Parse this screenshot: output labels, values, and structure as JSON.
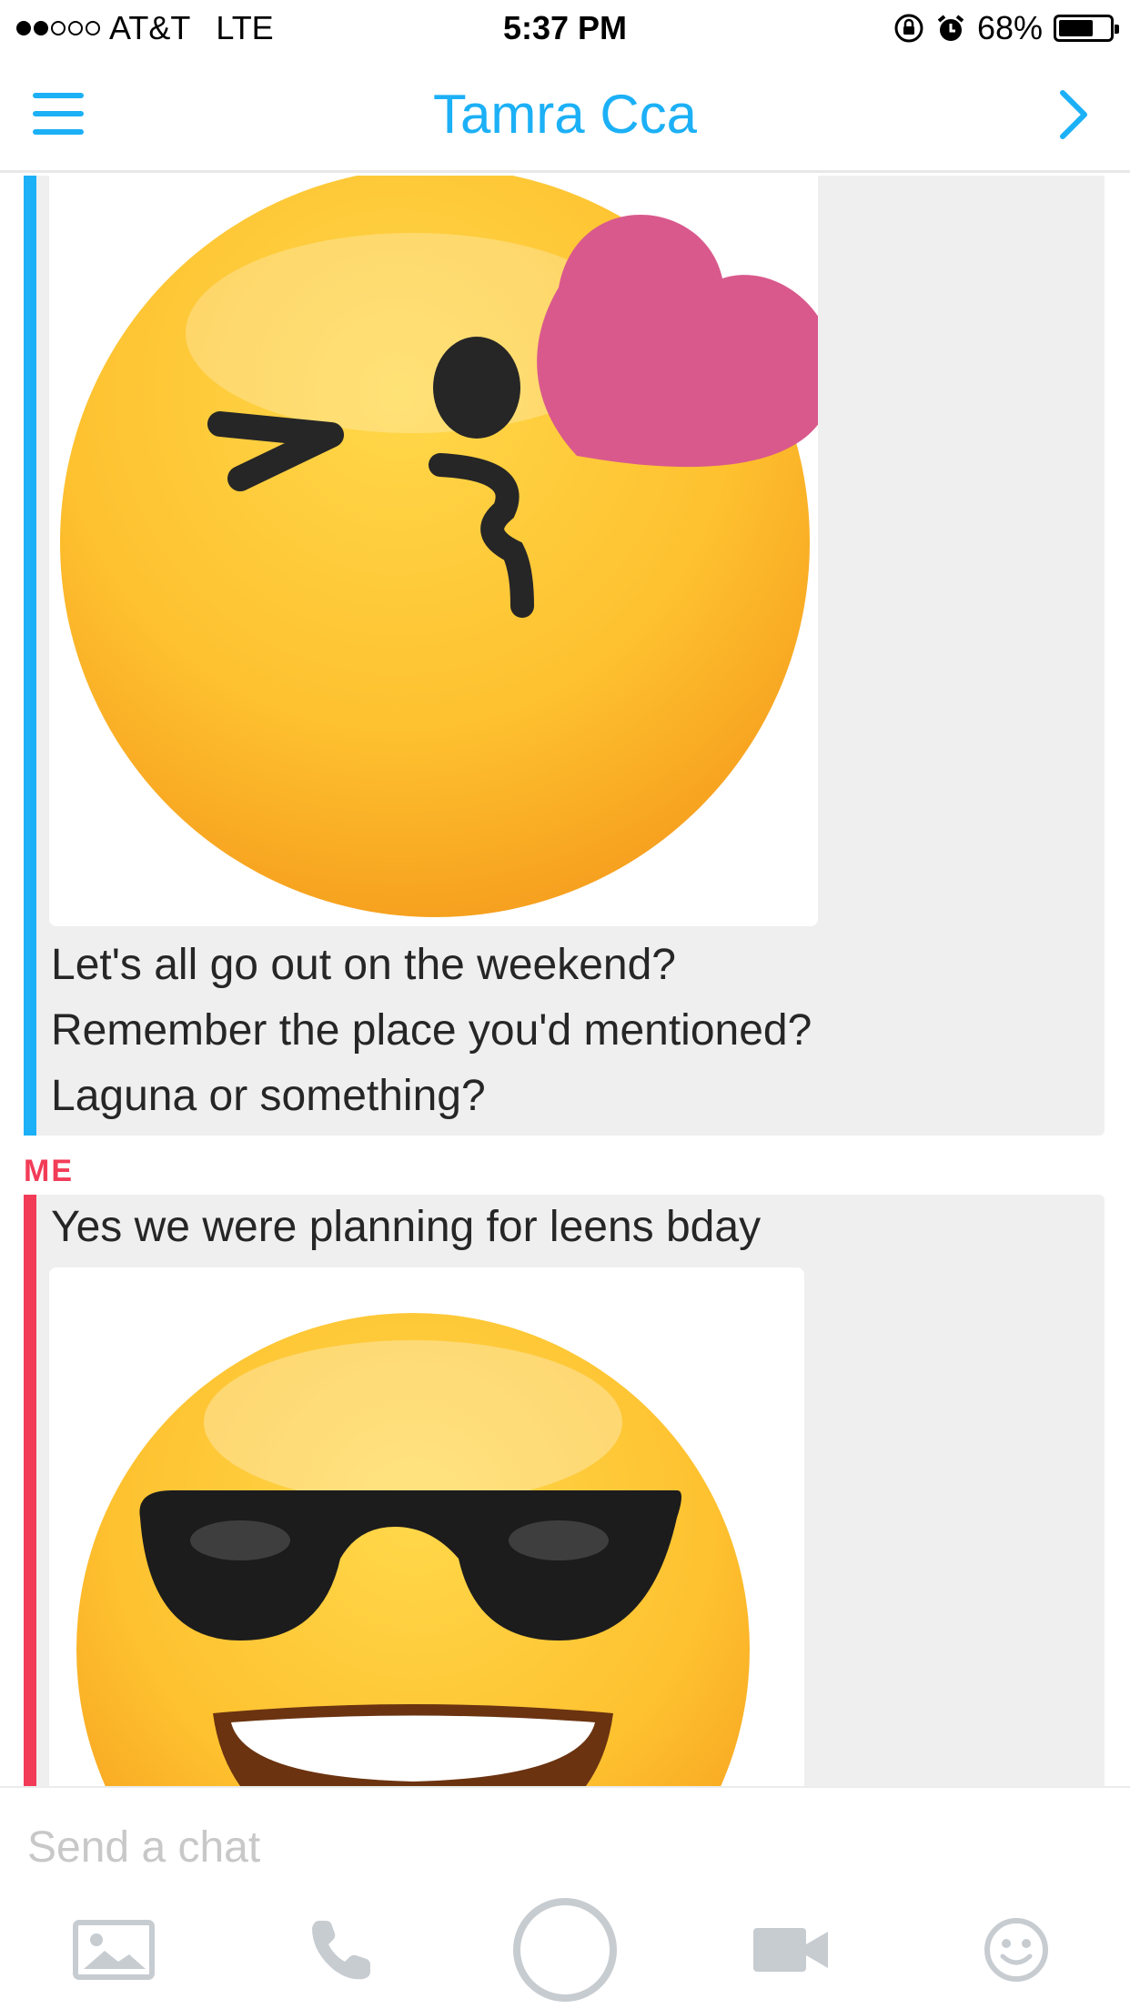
{
  "status_bar": {
    "carrier": "AT&T",
    "network": "LTE",
    "time": "5:37 PM",
    "battery_percent": "68%",
    "battery_level": 0.68,
    "signal_bars_filled": 2,
    "signal_bars_total": 5
  },
  "nav": {
    "title": "Tamra Cca",
    "menu_icon": "hamburger-menu-icon",
    "next_icon": "chevron-right-icon"
  },
  "messages": [
    {
      "sender": "",
      "accent": "#1cb0f6",
      "media": "winking-kiss-emoji",
      "lines": [
        "Let's all go out on the weekend?",
        "Remember the place you'd mentioned?",
        "Laguna or something?"
      ]
    },
    {
      "sender": "ME",
      "accent": "#f23c57",
      "lines": [
        "Yes we were planning for leens bday"
      ],
      "media": "sunglasses-emoji"
    }
  ],
  "composer": {
    "placeholder": "Send a chat",
    "tools": [
      "image-icon",
      "phone-icon",
      "capture-button",
      "video-icon",
      "emoji-icon"
    ]
  },
  "colors": {
    "brand_blue": "#1cb0f6",
    "me_red": "#f23c57",
    "bubble_bg": "#efefef",
    "icon_gray": "#c7ccd1"
  }
}
